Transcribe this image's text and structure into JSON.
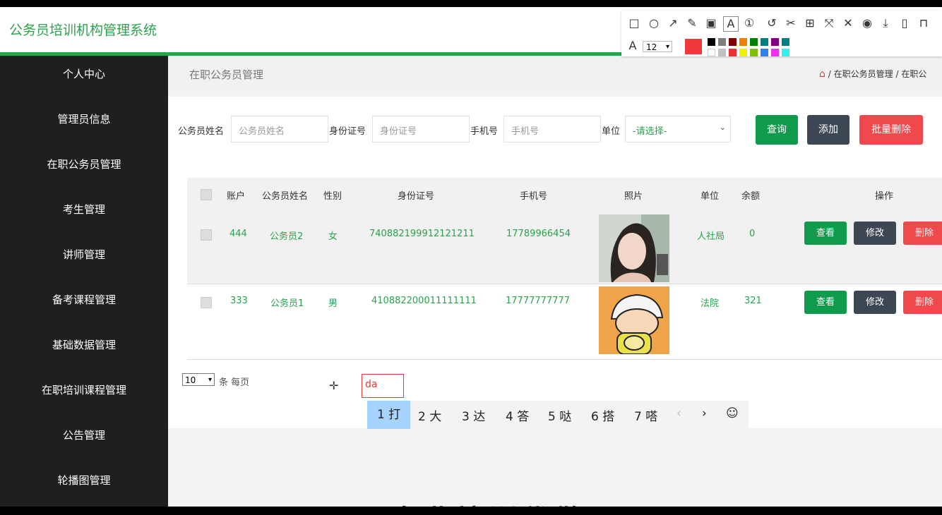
{
  "app": {
    "title": "公务员培训机构管理系统"
  },
  "sidebar": {
    "items": [
      {
        "label": "个人中心"
      },
      {
        "label": "管理员信息"
      },
      {
        "label": "在职公务员管理"
      },
      {
        "label": "考生管理"
      },
      {
        "label": "讲师管理"
      },
      {
        "label": "备考课程管理"
      },
      {
        "label": "基础数据管理"
      },
      {
        "label": "在职培训课程管理"
      },
      {
        "label": "公告管理"
      },
      {
        "label": "轮播图管理"
      }
    ]
  },
  "header": {
    "page_title": "在职公务员管理",
    "breadcrumb_sep": "/",
    "breadcrumb_1": "在职公务员管理",
    "breadcrumb_2": "在职公"
  },
  "filters": {
    "name_label": "公务员姓名",
    "name_placeholder": "公务员姓名",
    "id_label": "身份证号",
    "id_placeholder": "身份证号",
    "phone_label": "手机号",
    "phone_placeholder": "手机号",
    "unit_label": "单位",
    "unit_selected": "-请选择-"
  },
  "actions": {
    "query": "查询",
    "add": "添加",
    "batch_delete": "批量删除"
  },
  "table": {
    "columns": [
      "账户",
      "公务员姓名",
      "性别",
      "身份证号",
      "手机号",
      "照片",
      "单位",
      "余额",
      "操作"
    ],
    "rows": [
      {
        "account": "444",
        "name": "公务员2",
        "gender": "女",
        "id_no": "740882199912121211",
        "phone": "17789966454",
        "unit": "人社局",
        "balance": "0"
      },
      {
        "account": "333",
        "name": "公务员1",
        "gender": "男",
        "id_no": "410882200011111111",
        "phone": "17777777777",
        "unit": "法院",
        "balance": "321"
      }
    ],
    "row_actions": {
      "view": "查看",
      "edit": "修改",
      "delete": "删除"
    }
  },
  "pager": {
    "page_size": "10",
    "per_page_label": "条 每页"
  },
  "ime": {
    "composition": "da",
    "candidates": [
      "1 打",
      "2 大",
      "3 达",
      "4 答",
      "5 哒",
      "6 搭",
      "7 嗒"
    ],
    "prev": "‹",
    "next": "›",
    "emoji": "☺"
  },
  "background_text": "专业培训代做",
  "annotation_toolbar": {
    "font_size": "12",
    "active_color": "#f0393a",
    "tools": [
      "rectangle-icon",
      "ellipse-icon",
      "arrow-icon",
      "pencil-icon",
      "mosaic-icon",
      "text-icon",
      "number-icon",
      "undo-icon",
      "pin-icon",
      "ocr-icon",
      "translate-icon",
      "close-icon",
      "record-icon",
      "download-icon",
      "save-icon",
      "bookmark-icon"
    ],
    "palette": [
      "#000000",
      "#808080",
      "#800000",
      "#f08000",
      "#008000",
      "#008080",
      "#800080",
      "#008080",
      "#ffffff",
      "#c0c0c0",
      "#f03030",
      "#f0f000",
      "#80c000",
      "#3080f0",
      "#f030f0",
      "#30f0f0"
    ]
  }
}
